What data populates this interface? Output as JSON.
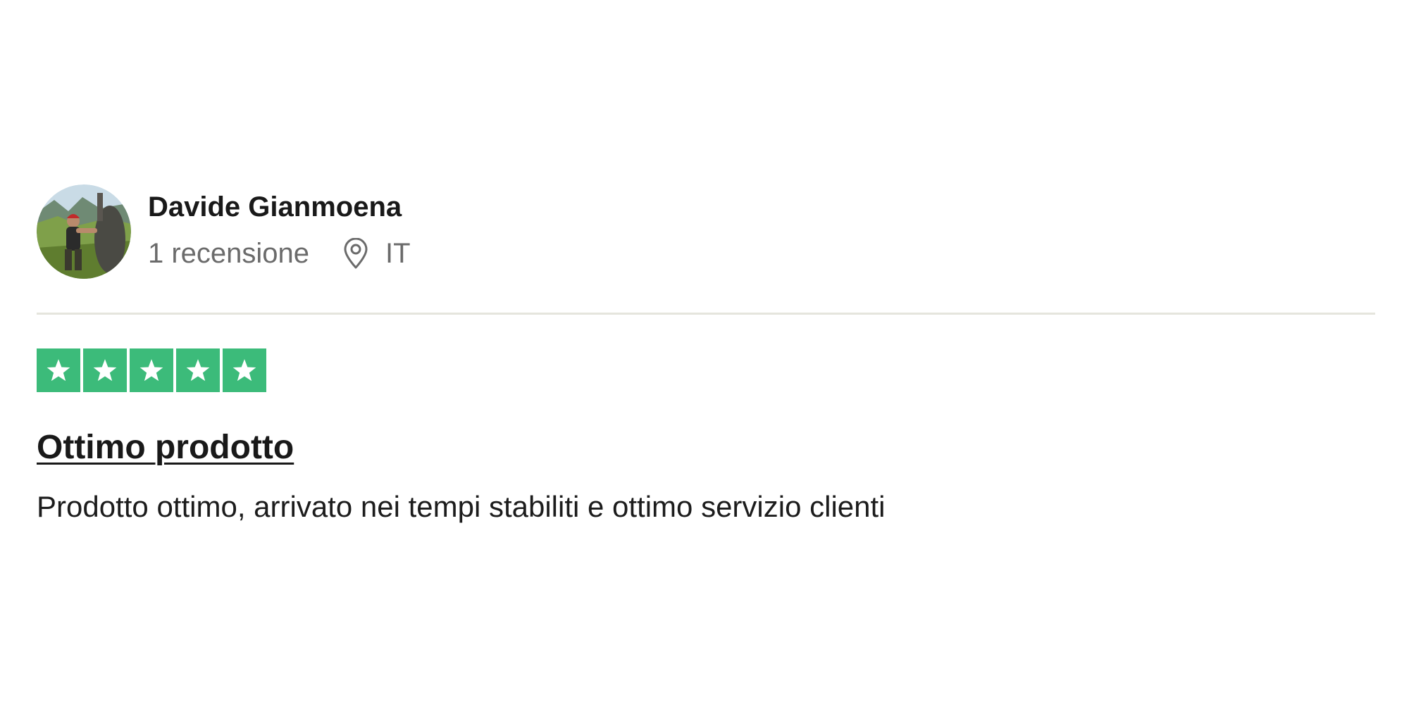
{
  "reviewer": {
    "name": "Davide Gianmoena",
    "review_count": "1 recensione",
    "country": "IT",
    "avatar_icon": "profile-photo"
  },
  "rating": {
    "stars": 5,
    "max_stars": 5,
    "color": "#3cbb7a"
  },
  "review": {
    "title": "Ottimo prodotto",
    "body": "Prodotto ottimo, arrivato nei tempi stabiliti e ottimo servizio clienti"
  }
}
